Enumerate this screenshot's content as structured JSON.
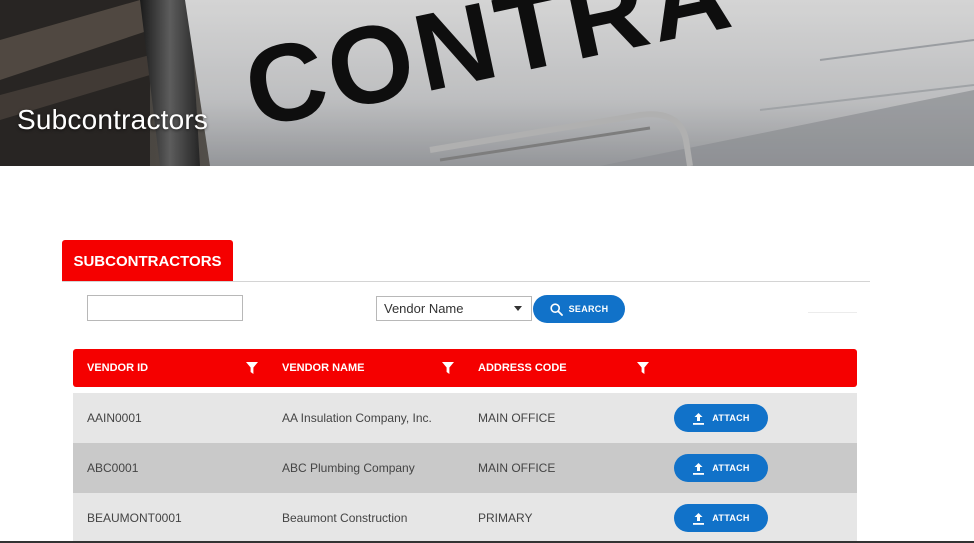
{
  "banner": {
    "title": "Subcontractors",
    "background_text": "CONTRA"
  },
  "tabs": [
    {
      "label": "SUBCONTRACTORS",
      "active": true
    }
  ],
  "filters": {
    "search_value": "",
    "select_value": "Vendor Name",
    "search_button_label": "SEARCH"
  },
  "grid": {
    "columns": [
      {
        "label": "VENDOR ID",
        "filter_icon": "filter-icon"
      },
      {
        "label": "VENDOR NAME",
        "filter_icon": "filter-icon"
      },
      {
        "label": "ADDRESS CODE",
        "filter_icon": "filter-icon"
      }
    ],
    "rows": [
      {
        "vendor_id": "AAIN0001",
        "vendor_name": "AA Insulation Company, Inc.",
        "address_code": "MAIN OFFICE",
        "action_label": "ATTACH"
      },
      {
        "vendor_id": "ABC0001",
        "vendor_name": "ABC Plumbing Company",
        "address_code": "MAIN OFFICE",
        "action_label": "ATTACH"
      },
      {
        "vendor_id": "BEAUMONT0001",
        "vendor_name": "Beaumont Construction",
        "address_code": "PRIMARY",
        "action_label": "ATTACH"
      }
    ]
  },
  "colors": {
    "accent_red": "#f50000",
    "button_blue": "#1172c9",
    "row_odd": "#e6e6e6",
    "row_even": "#c9c9c9"
  }
}
